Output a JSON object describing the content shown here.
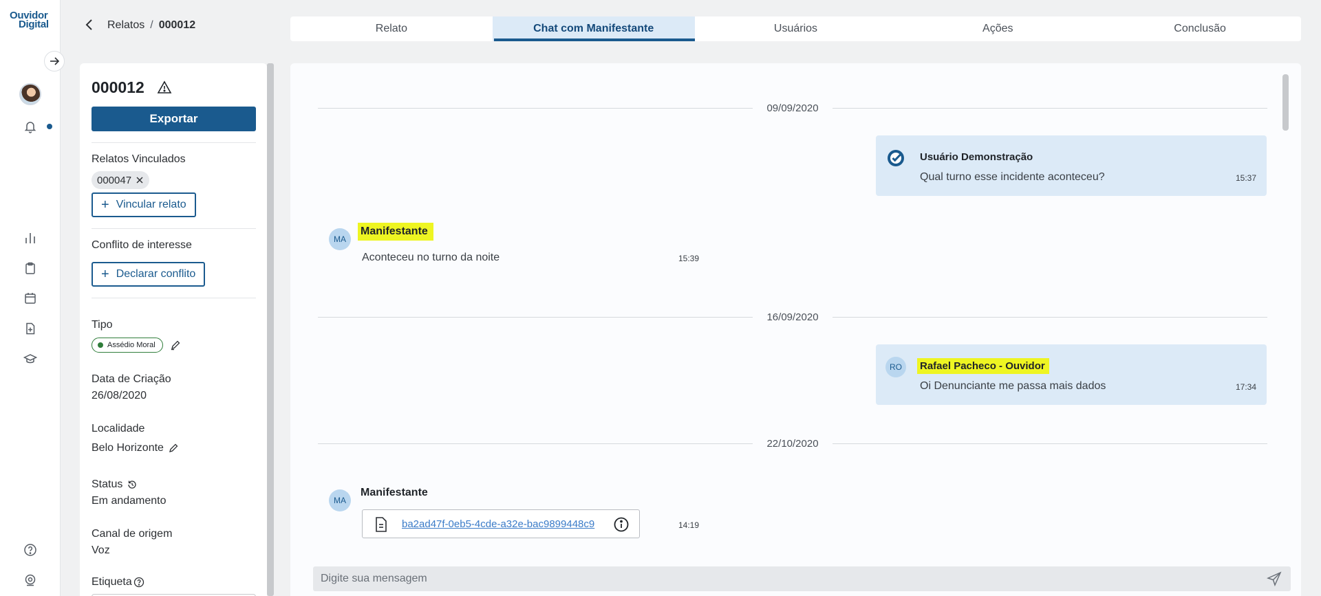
{
  "app": {
    "logo_line1": "Ouvidor",
    "logo_line2": "Digital"
  },
  "breadcrumb": {
    "parent": "Relatos",
    "separator": "/",
    "current": "000012"
  },
  "tabs": [
    {
      "label": "Relato",
      "active": false
    },
    {
      "label": "Chat com Manifestante",
      "active": true
    },
    {
      "label": "Usuários",
      "active": false
    },
    {
      "label": "Ações",
      "active": false
    },
    {
      "label": "Conclusão",
      "active": false
    }
  ],
  "details": {
    "title": "000012",
    "export_label": "Exportar",
    "linked_label": "Relatos Vinculados",
    "linked_items": [
      "000047"
    ],
    "link_button": "Vincular relato",
    "conflict_label": "Conflito de interesse",
    "conflict_button": "Declarar conflito",
    "type_label": "Tipo",
    "type_value": "Assédio Moral",
    "created_label": "Data de Criação",
    "created_value": "26/08/2020",
    "location_label": "Localidade",
    "location_value": "Belo Horizonte",
    "status_label": "Status",
    "status_value": "Em andamento",
    "channel_label": "Canal de origem",
    "channel_value": "Voz",
    "tag_label": "Etiqueta"
  },
  "chat": {
    "dates": [
      "09/09/2020",
      "16/09/2020",
      "22/10/2020"
    ],
    "messages": [
      {
        "author": "Usuário Demonstração",
        "text": "Qual turno esse incidente aconteceu?",
        "time": "15:37"
      },
      {
        "initials": "MA",
        "author": "Manifestante",
        "text": "Aconteceu no turno da noite",
        "time": "15:39"
      },
      {
        "initials": "RO",
        "author": "Rafael Pacheco - Ouvidor",
        "text": "Oi Denunciante me passa mais dados",
        "time": "17:34"
      },
      {
        "initials": "MA",
        "author": "Manifestante",
        "file": "ba2ad47f-0eb5-4cde-a32e-bac9899448c9",
        "time": "14:19"
      }
    ],
    "composer_placeholder": "Digite sua mensagem"
  },
  "colors": {
    "primary": "#1a5a8e",
    "tab_active_bg": "#dceaf7",
    "highlight": "#eef522",
    "tag_green": "#2f7d3a"
  }
}
